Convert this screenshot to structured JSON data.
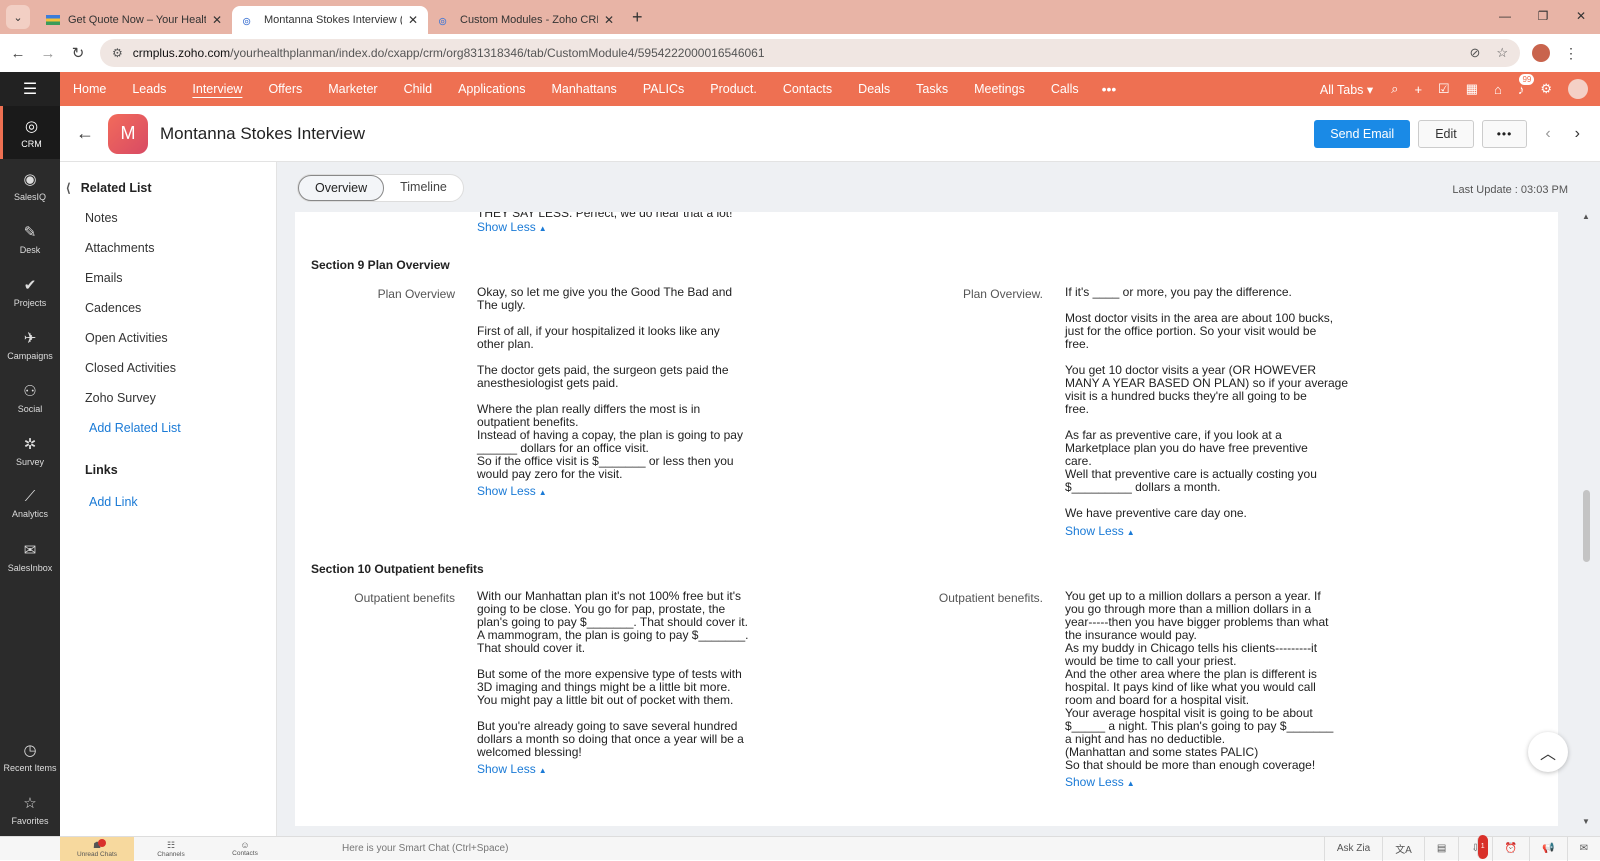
{
  "browser": {
    "tabs": [
      {
        "title": "Get Quote Now – Your Health P"
      },
      {
        "title": "Montanna Stokes Interview (Int"
      },
      {
        "title": "Custom Modules - Zoho CRM"
      }
    ],
    "url_host": "crmplus.zoho.com",
    "url_path": "/yourhealthplanman/index.do/cxapp/crm/org831318346/tab/CustomModule4/5954222000016546061"
  },
  "topnav": {
    "items": [
      "Home",
      "Leads",
      "Interview",
      "Offers",
      "Marketer",
      "Child",
      "Applications",
      "Manhattans",
      "PALICs",
      "Product.",
      "Contacts",
      "Deals",
      "Tasks",
      "Meetings",
      "Calls"
    ],
    "more": "•••",
    "all_tabs": "All Tabs ▾",
    "notif_count": "99"
  },
  "rail": {
    "items": [
      {
        "label": "CRM",
        "icon": "crm-icon"
      },
      {
        "label": "SalesIQ",
        "icon": "salesiq-icon"
      },
      {
        "label": "Desk",
        "icon": "desk-icon"
      },
      {
        "label": "Projects",
        "icon": "projects-icon"
      },
      {
        "label": "Campaigns",
        "icon": "campaigns-icon"
      },
      {
        "label": "Social",
        "icon": "social-icon"
      },
      {
        "label": "Survey",
        "icon": "survey-icon"
      },
      {
        "label": "Analytics",
        "icon": "analytics-icon"
      },
      {
        "label": "SalesInbox",
        "icon": "salesinbox-icon"
      }
    ],
    "recent": "Recent Items",
    "favorites": "Favorites"
  },
  "record": {
    "avatar_letter": "M",
    "title": "Montanna Stokes Interview",
    "send_email": "Send Email",
    "edit": "Edit",
    "more": "•••"
  },
  "related": {
    "heading": "Related List",
    "items": [
      "Notes",
      "Attachments",
      "Emails",
      "Cadences",
      "Open Activities",
      "Closed Activities",
      "Zoho Survey"
    ],
    "add_related": "Add Related List",
    "links_heading": "Links",
    "add_link": "Add Link"
  },
  "main": {
    "tabs": [
      "Overview",
      "Timeline"
    ],
    "last_update": "Last Update : 03:03 PM",
    "top_cut_text": "THEY SAY LESS: Perfect, we do hear that a lot!",
    "show_less": "Show Less",
    "section9": {
      "title": "Section 9 Plan Overview",
      "left_label": "Plan Overview",
      "left_value": "Okay, so let me give you the Good The Bad and\nThe ugly.\n\nFirst of all, if your hospitalized it looks like any\nother plan.\n\nThe doctor gets paid, the surgeon gets paid the\nanesthesiologist gets paid.\n\nWhere the plan really differs the most is in\noutpatient benefits.\nInstead of having a copay, the plan is going to pay\n______ dollars for an office visit.\n So if the office visit is $_______ or less then you\nwould pay zero for the visit.",
      "right_label": "Plan Overview.",
      "right_value": "If it's ____ or more, you pay the difference.\n\nMost doctor visits in the area are about 100 bucks,\njust for the office portion. So your visit would be\nfree.\n\nYou get 10 doctor visits a year (OR HOWEVER\nMANY A YEAR BASED ON PLAN) so if your average\nvisit is a hundred bucks they're all going to be\nfree.\n\nAs far as preventive care, if you look at a\nMarketplace plan you do have free preventive\ncare.\nWell that preventive care is actually costing you\n$_________ dollars a month.\n\nWe have preventive care day one."
    },
    "section10": {
      "title": "Section 10 Outpatient benefits",
      "left_label": "Outpatient benefits",
      "left_value": "With our Manhattan plan it's not 100% free but it's\ngoing to be close. You go for pap, prostate, the\nplan's going to pay $_______. That should cover it.\nA mammogram, the plan is going to pay $_______.\nThat should cover it.\n\nBut some of the more expensive type of tests with\n3D imaging and things might be a little bit more.\nYou might pay a little bit out of pocket with them.\n\nBut you're already going to save several hundred\ndollars a month so doing that once a year will be a\nwelcomed blessing!",
      "right_label": "Outpatient benefits.",
      "right_value": "You get up to a million dollars a person a year. If\nyou go through more than a million dollars in a\nyear-----then you have bigger problems than what\nthe insurance would pay.\nAs my buddy in Chicago tells his clients---------it\nwould be time to call your priest.\nAnd the other area where the plan is different is\nhospital. It pays kind of like what you would call\nroom and board for a hospital visit.\nYour average hospital visit is going to be about\n$_____ a night. This plan's going to pay $_______\na night and has no deductible.\n(Manhattan and some states PALIC)\nSo that should be more than enough coverage!"
    }
  },
  "footer": {
    "tabs": [
      "Unread Chats",
      "Channels",
      "Contacts"
    ],
    "smart_chat": "Here is your Smart Chat (Ctrl+Space)",
    "ask_zia": "Ask Zia",
    "badge": "1"
  }
}
